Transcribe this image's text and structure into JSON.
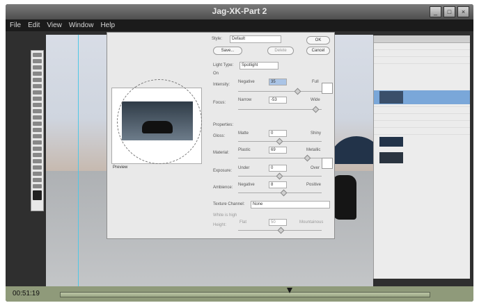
{
  "window": {
    "title": "Jag-XK-Part 2",
    "menu": [
      "File",
      "Edit",
      "View",
      "Window",
      "Help"
    ],
    "controls": {
      "minimize": "_",
      "maximize": "□",
      "close": "×"
    }
  },
  "lighting_dialog": {
    "style_label": "Style:",
    "style_value": "Default",
    "buttons": {
      "save": "Save...",
      "delete": "Delete",
      "ok": "OK",
      "cancel": "Cancel"
    },
    "light_type_label": "Light Type:",
    "light_type_value": "Spotlight",
    "on_label": "On",
    "intensity": {
      "label": "Intensity:",
      "min": "Negative",
      "max": "Full",
      "value": "35"
    },
    "focus": {
      "label": "Focus:",
      "min": "Narrow",
      "max": "Wide",
      "value": "-53"
    },
    "properties_label": "Properties:",
    "gloss": {
      "label": "Gloss:",
      "min": "Matte",
      "max": "Shiny",
      "value": "0"
    },
    "material": {
      "label": "Material:",
      "min": "Plastic",
      "max": "Metallic",
      "value": "69"
    },
    "exposure": {
      "label": "Exposure:",
      "min": "Under",
      "max": "Over",
      "value": "0"
    },
    "ambience": {
      "label": "Ambience:",
      "min": "Negative",
      "max": "Positive",
      "value": "8"
    },
    "texture_label": "Texture Channel:",
    "texture_value": "None",
    "white_high_label": "White is high",
    "height": {
      "label": "Height:",
      "min": "Flat",
      "max": "Mountainous",
      "value": "50"
    },
    "preview_label": "Preview"
  },
  "timeline": {
    "time": "00:51:19",
    "progress": 0.66
  }
}
